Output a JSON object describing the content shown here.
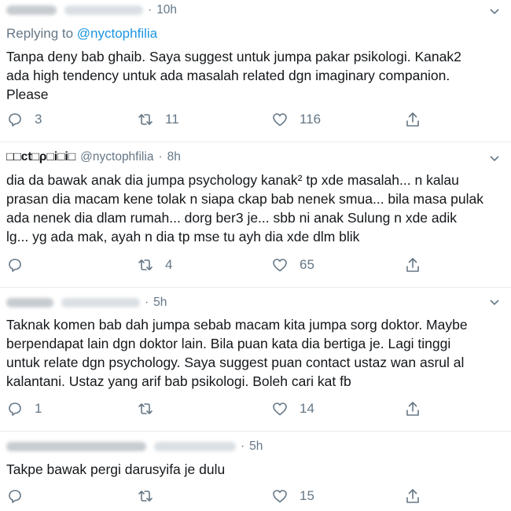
{
  "tweets": [
    {
      "display_name": "",
      "handle": "",
      "time": "10h",
      "replying_prefix": "Replying to",
      "replying_to": "@nyctophfilia",
      "text": "Tanpa deny bab ghaib. Saya suggest untuk jumpa pakar psikologi. Kanak2\nada high tendency untuk ada masalah related dgn imaginary companion.\nPlease",
      "replies": "3",
      "retweets": "11",
      "likes": "116"
    },
    {
      "display_name": "□□ct□ρ□i□i□",
      "handle": "@nyctophfilia",
      "time": "8h",
      "text": "dia da bawak anak dia jumpa psychology kanak² tp xde masalah... n kalau\nprasan dia macam kene tolak n siapa ckap bab nenek smua... bila masa pulak\nada nenek dia dlam rumah... dorg ber3 je... sbb ni anak Sulung n xde adik\nlg... yg ada mak, ayah n dia tp mse tu ayh dia xde dlm blik",
      "replies": "",
      "retweets": "4",
      "likes": "65"
    },
    {
      "display_name": "",
      "handle": "",
      "time": "5h",
      "text": "Taknak komen bab dah jumpa sebab macam kita jumpa sorg doktor. Maybe\nberpendapat lain dgn doktor lain. Bila puan kata dia bertiga je. Lagi tinggi\nuntuk relate dgn psychology. Saya suggest puan contact ustaz wan asrul al\nkalantani. Ustaz yang arif bab psikologi. Boleh cari kat fb",
      "replies": "1",
      "retweets": "",
      "likes": "14"
    },
    {
      "display_name": "",
      "handle": "",
      "time": "5h",
      "text": "Takpe bawak pergi darusyifa je dulu",
      "replies": "",
      "retweets": "",
      "likes": "15"
    }
  ],
  "icons": [
    "reply-icon",
    "retweet-icon",
    "like-icon",
    "share-icon",
    "caret-down-icon"
  ],
  "colors": {
    "secondary_text": "#657786",
    "link": "#1b95e0",
    "divider": "#e6ecf0"
  }
}
